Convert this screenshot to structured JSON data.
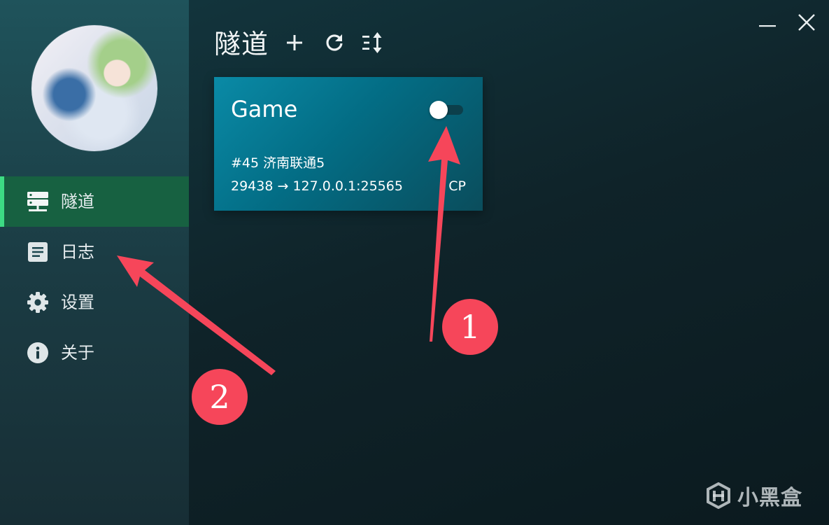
{
  "sidebar": {
    "items": [
      {
        "label": "隧道",
        "icon": "server-icon",
        "active": true
      },
      {
        "label": "日志",
        "icon": "document-icon",
        "active": false
      },
      {
        "label": "设置",
        "icon": "gear-icon",
        "active": false
      },
      {
        "label": "关于",
        "icon": "info-icon",
        "active": false
      }
    ]
  },
  "main": {
    "title": "隧道",
    "toolbar": {
      "icons": [
        "plus-icon",
        "refresh-icon",
        "sort-icon"
      ]
    },
    "tunnels": [
      {
        "name": "Game",
        "node": "#45 济南联通5",
        "mapping": "29438 → 127.0.0.1:25565",
        "protocol": "CP",
        "enabled": false
      }
    ]
  },
  "window_controls": {
    "icons": [
      "minimize-icon",
      "close-icon"
    ]
  },
  "annotations": {
    "badges": [
      "1",
      "2"
    ],
    "color": "#f6465a"
  },
  "watermark": {
    "text": "小黑盒"
  },
  "colors": {
    "sidebar": "#1f535b",
    "active_nav": "#176141",
    "active_indicator": "#3ddc84",
    "card": "#0a8aa6",
    "background": "#0f2329"
  }
}
